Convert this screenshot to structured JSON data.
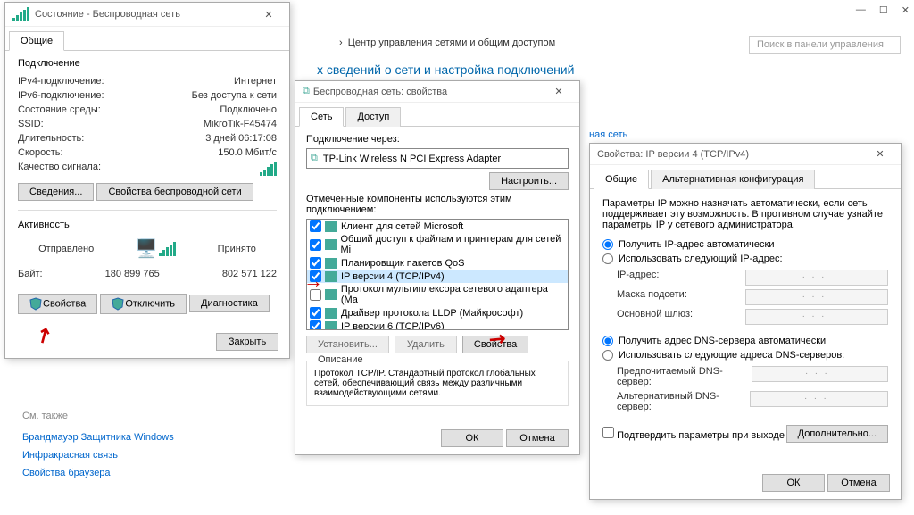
{
  "header": {
    "breadcrumb_sep": "›",
    "breadcrumb": "Центр управления сетями и общим доступом",
    "search_placeholder": "Поиск в панели управления",
    "subtitle": "х сведений о сети и настройка подключений",
    "netlink": "ная сеть"
  },
  "status": {
    "title": "Состояние - Беспроводная сеть",
    "tab": "Общие",
    "conn_header": "Подключение",
    "ipv4_l": "IPv4-подключение:",
    "ipv4_v": "Интернет",
    "ipv6_l": "IPv6-подключение:",
    "ipv6_v": "Без доступа к сети",
    "media_l": "Состояние среды:",
    "media_v": "Подключено",
    "ssid_l": "SSID:",
    "ssid_v": "MikroTik-F45474",
    "dur_l": "Длительность:",
    "dur_v": "3 дней 06:17:08",
    "speed_l": "Скорость:",
    "speed_v": "150.0 Мбит/c",
    "signal_l": "Качество сигнала:",
    "details_btn": "Сведения...",
    "wprops_btn": "Свойства беспроводной сети",
    "activity_header": "Активность",
    "sent": "Отправлено",
    "recv": "Принято",
    "bytes_l": "Байт:",
    "sent_v": "180 899 765",
    "recv_v": "802 571 122",
    "props_btn": "Свойства",
    "disable_btn": "Отключить",
    "diag_btn": "Диагностика",
    "close_btn": "Закрыть"
  },
  "props": {
    "title": "Беспроводная сеть: свойства",
    "tab1": "Сеть",
    "tab2": "Доступ",
    "conn_via": "Подключение через:",
    "adapter": "TP-Link Wireless N PCI Express Adapter",
    "configure_btn": "Настроить...",
    "comp_label": "Отмеченные компоненты используются этим подключением:",
    "items": [
      {
        "chk": true,
        "label": "Клиент для сетей Microsoft"
      },
      {
        "chk": true,
        "label": "Общий доступ к файлам и принтерам для сетей Mi"
      },
      {
        "chk": true,
        "label": "Планировщик пакетов QoS"
      },
      {
        "chk": true,
        "label": "IP версии 4 (TCP/IPv4)",
        "sel": true
      },
      {
        "chk": false,
        "label": "Протокол мультиплексора сетевого адаптера (Ма"
      },
      {
        "chk": true,
        "label": "Драйвер протокола LLDP (Майкрософт)"
      },
      {
        "chk": true,
        "label": "IP версии 6 (TCP/IPv6)"
      }
    ],
    "install_btn": "Установить...",
    "remove_btn": "Удалить",
    "props_btn": "Свойства",
    "desc_header": "Описание",
    "desc": "Протокол TCP/IP. Стандартный протокол глобальных сетей, обеспечивающий связь между различными взаимодействующими сетями.",
    "ok": "ОК",
    "cancel": "Отмена"
  },
  "ipv4": {
    "title": "Свойства: IP версии 4 (TCP/IPv4)",
    "tab1": "Общие",
    "tab2": "Альтернативная конфигурация",
    "intro": "Параметры IP можно назначать автоматически, если сеть поддерживает эту возможность. В противном случае узнайте параметры IP у сетевого администратора.",
    "r1": "Получить IP-адрес автоматически",
    "r2": "Использовать следующий IP-адрес:",
    "ip_l": "IP-адрес:",
    "mask_l": "Маска подсети:",
    "gw_l": "Основной шлюз:",
    "r3": "Получить адрес DNS-сервера автоматически",
    "r4": "Использовать следующие адреса DNS-серверов:",
    "dns1_l": "Предпочитаемый DNS-сервер:",
    "dns2_l": "Альтернативный DNS-сервер:",
    "validate": "Подтвердить параметры при выходе",
    "adv_btn": "Дополнительно...",
    "ok": "ОК",
    "cancel": "Отмена"
  },
  "side": {
    "see_also": "См. также",
    "l1": "Брандмауэр Защитника Windows",
    "l2": "Инфракрасная связь",
    "l3": "Свойства браузера"
  }
}
